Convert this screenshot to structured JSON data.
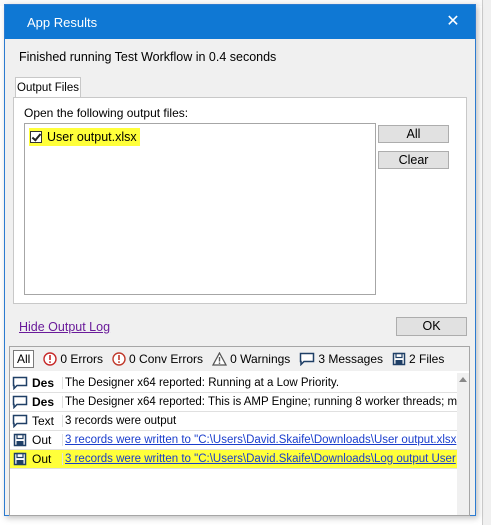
{
  "dialog": {
    "title": "App Results",
    "close_glyph": "✕",
    "status": "Finished running Test Workflow in 0.4 seconds"
  },
  "tabs": [
    {
      "label": "Output Files"
    }
  ],
  "output_files": {
    "label": "Open the following output files:",
    "items": [
      {
        "name": "User output.xlsx",
        "checked": true
      }
    ],
    "all_button": "All",
    "clear_button": "Clear"
  },
  "hide_log_link": "Hide Output Log",
  "ok_button": "OK",
  "log": {
    "filters": {
      "all": "All",
      "errors": "0 Errors",
      "conv_errors": "0 Conv Errors",
      "warnings": "0 Warnings",
      "messages": "3 Messages",
      "files": "2 Files"
    },
    "rows": [
      {
        "icon": "message-icon",
        "type": "Des",
        "message": "The Designer x64 reported: Running at a Low Priority."
      },
      {
        "icon": "message-icon",
        "type": "Des",
        "message": "The Designer x64 reported: This is AMP Engine; running 8 worker threads; m"
      },
      {
        "icon": "message-icon",
        "type": "Text",
        "message": "3 records were output"
      },
      {
        "icon": "file-icon",
        "type": "Out",
        "message": "3 records were written to \"C:\\Users\\David.Skaife\\Downloads\\User output.xlsx"
      },
      {
        "icon": "file-icon",
        "type": "Out",
        "message": "3 records were written to \"C:\\Users\\David.Skaife\\Downloads\\Log output User"
      }
    ]
  },
  "colors": {
    "title_bar": "#0f78d4",
    "highlight": "#ffff3a",
    "link": "#1a3dcc",
    "visited_link": "#6a1b9a"
  }
}
